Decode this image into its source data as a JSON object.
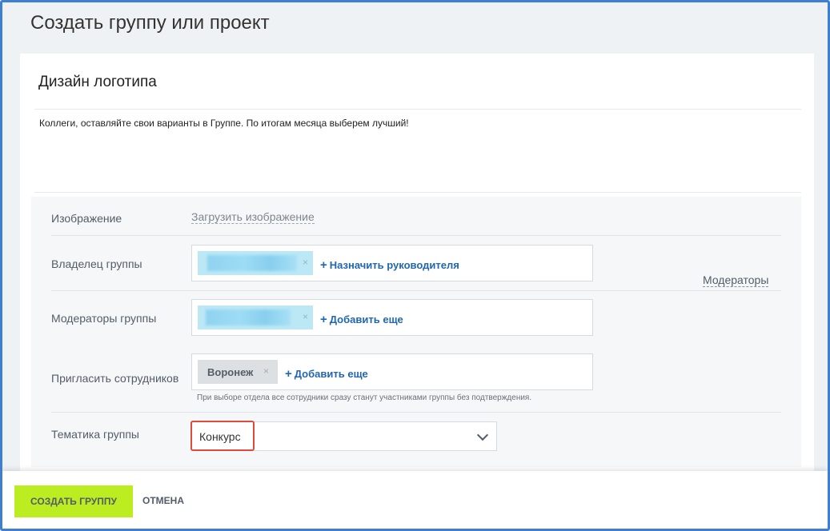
{
  "page": {
    "title": "Создать группу или проект"
  },
  "group": {
    "name": "Дизайн логотипа",
    "description": "Коллеги, оставляйте свои варианты в Группе. По итогам месяца выберем лучший!"
  },
  "settings": {
    "image": {
      "label": "Изображение",
      "upload_link": "Загрузить изображение"
    },
    "owner": {
      "label": "Владелец группы",
      "add_link": "Назначить руководителя",
      "moderators_link": "Модераторы"
    },
    "moderators": {
      "label": "Модераторы группы",
      "add_link": "Добавить еще"
    },
    "invite": {
      "label": "Пригласить сотрудников",
      "tag": "Воронеж",
      "add_link": "Добавить еще",
      "hint": "При выборе отдела все сотрудники сразу станут участниками группы без подтверждения."
    },
    "theme": {
      "label": "Тематика группы",
      "value": "Конкурс"
    }
  },
  "footer": {
    "create_label": "СОЗДАТЬ ГРУППУ",
    "cancel_label": "ОТМЕНА"
  },
  "colors": {
    "frame_border": "#3e7fd1",
    "create_button": "#bbed21",
    "link": "#2067b0",
    "highlight_border": "#e04a3a",
    "user_tag": "#bce8f6"
  }
}
